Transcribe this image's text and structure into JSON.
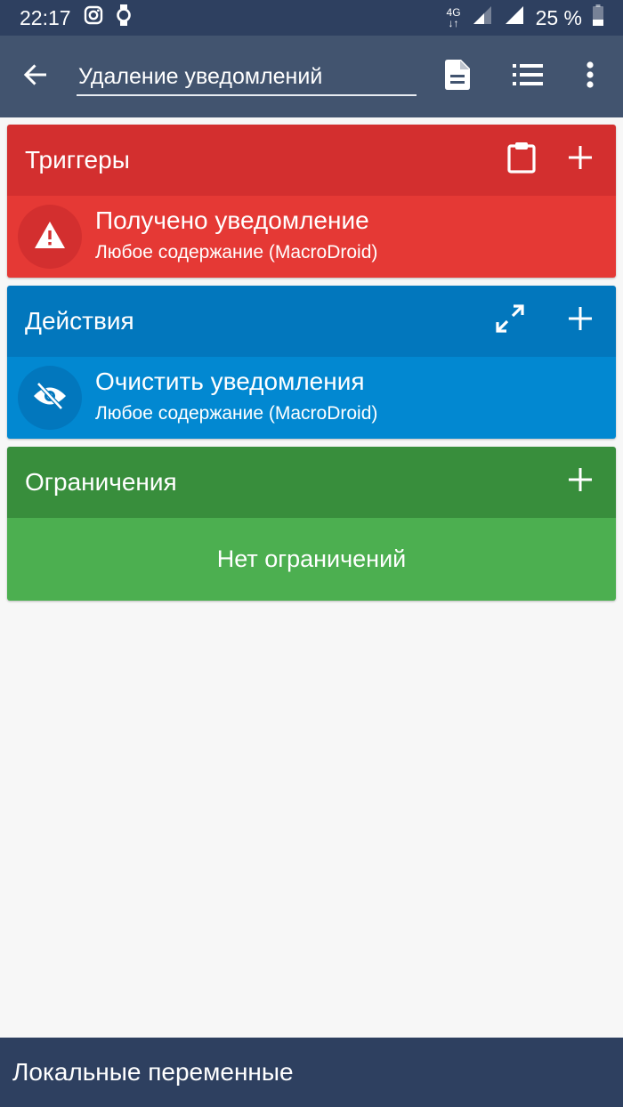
{
  "status": {
    "time": "22:17",
    "network": "4G",
    "battery": "25 %",
    "icons": [
      "instagram-icon",
      "watch-icon",
      "signal-icon",
      "battery-icon"
    ]
  },
  "appbar": {
    "macro_name": "Удаление уведомлений",
    "icons": [
      "back-arrow-icon",
      "document-icon",
      "list-icon",
      "more-vert-icon"
    ]
  },
  "triggers": {
    "title": "Триггеры",
    "items": [
      {
        "title": "Получено уведомление",
        "subtitle": "Любое содержание (MacroDroid)",
        "icon": "warning-icon"
      }
    ]
  },
  "actions": {
    "title": "Действия",
    "items": [
      {
        "title": "Очистить уведомления",
        "subtitle": "Любое содержание (MacroDroid)",
        "icon": "eye-off-icon"
      }
    ]
  },
  "constraints": {
    "title": "Ограничения",
    "empty_text": "Нет ограничений"
  },
  "bottom": {
    "label": "Локальные переменные"
  },
  "colors": {
    "status_bar": "#2e4060",
    "app_bar": "#42546f",
    "trigger_header": "#d32f2f",
    "trigger_body": "#e53935",
    "action_header": "#0277bd",
    "action_body": "#0288d1",
    "constraint_header": "#388e3c",
    "constraint_body": "#4caf50"
  }
}
